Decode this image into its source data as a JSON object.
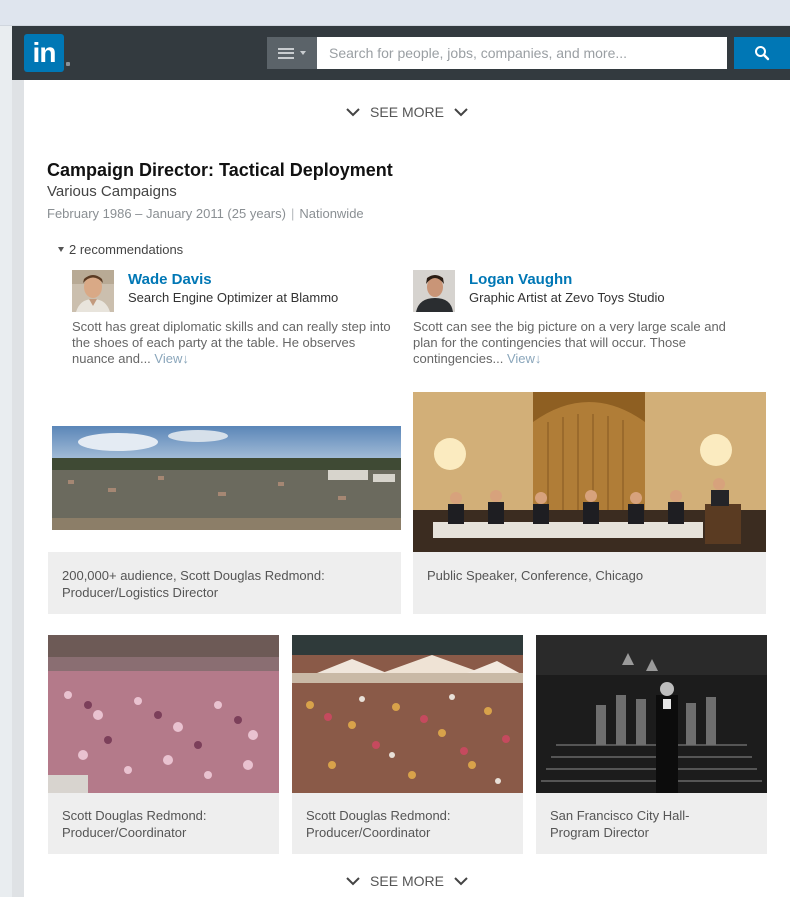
{
  "header": {
    "logo_text": "in",
    "search_placeholder": "Search for people, jobs, companies, and more...",
    "brand_color": "#0077b5"
  },
  "see_more_top": "SEE MORE",
  "see_more_bottom": "SEE MORE",
  "position": {
    "title": "Campaign Director: Tactical Deployment",
    "organization": "Various Campaigns",
    "dates": "February 1986 – January 2011 (25 years)",
    "separator": "|",
    "location": "Nationwide"
  },
  "recommendations": {
    "toggle_label": "2 recommendations",
    "items": [
      {
        "name": "Wade Davis",
        "role": "Search Engine Optimizer at Blammo",
        "quote": "Scott has great diplomatic skills and can really step into the shoes of each party at the table. He observes nuance and...",
        "view_label": "View"
      },
      {
        "name": "Logan Vaughn",
        "role": "Graphic Artist at Zevo Toys Studio",
        "quote": "Scott can see the big picture on a very large scale and plan for the contingencies that will occur. Those contingencies...",
        "view_label": "View"
      }
    ]
  },
  "media": [
    {
      "caption_line1": "200,000+ audience, Scott Douglas Redmond:",
      "caption_line2": "Producer/Logistics Director"
    },
    {
      "caption_line1": "Public Speaker, Conference, Chicago",
      "caption_line2": ""
    },
    {
      "caption_line1": "Scott Douglas Redmond:",
      "caption_line2": "Producer/Coordinator"
    },
    {
      "caption_line1": "Scott Douglas Redmond:",
      "caption_line2": "Producer/Coordinator"
    },
    {
      "caption_line1": "San Francisco City Hall-",
      "caption_line2": "Program Director"
    }
  ]
}
